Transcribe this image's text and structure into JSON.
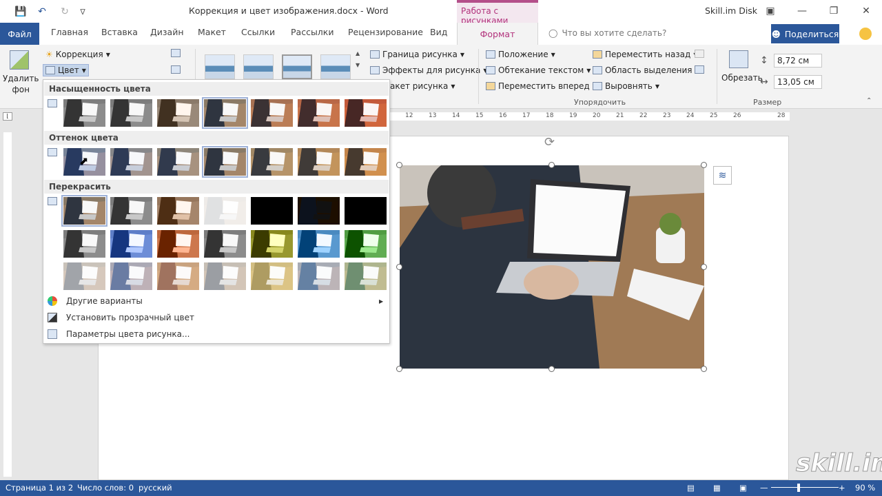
{
  "titlebar": {
    "doc_title": "Коррекция и цвет изображения.docx  -  Word",
    "context_title": "Работа с рисунками",
    "account": "Skill.im Disk",
    "qat_icons": [
      "save-icon",
      "undo-icon",
      "redo-icon",
      "customize-icon"
    ]
  },
  "tabs": {
    "file": "Файл",
    "items": [
      "Главная",
      "Вставка",
      "Дизайн",
      "Макет",
      "Ссылки",
      "Рассылки",
      "Рецензирование",
      "Вид"
    ],
    "format": "Формат",
    "tell_me": "Что вы хотите сделать?",
    "share": "Поделиться"
  },
  "ribbon": {
    "remove_bg": "Удалить фон",
    "correction": "Коррекция",
    "color": "Цвет",
    "border": "Граница рисунка",
    "effects": "Эффекты для рисунка",
    "layout": "акет рисунка",
    "position": "Положение",
    "wrap": "Обтекание текстом",
    "forward": "Переместить вперед",
    "backward": "Переместить назад",
    "selection": "Область выделения",
    "align": "Выровнять",
    "arrange_label": "Упорядочить",
    "crop": "Обрезать",
    "height": "8,72 см",
    "width": "13,05 см",
    "size_label": "Размер"
  },
  "dropdown": {
    "saturation_header": "Насыщенность цвета",
    "tone_header": "Оттенок цвета",
    "recolor_header": "Перекрасить",
    "more": "Другие варианты",
    "transparent": "Установить прозрачный цвет",
    "options": "Параметры цвета рисунка..."
  },
  "ruler": {
    "ticks": [
      "12",
      "13",
      "14",
      "15",
      "16",
      "17",
      "18",
      "19",
      "20",
      "21",
      "22",
      "23",
      "24",
      "25",
      "26",
      "28"
    ]
  },
  "statusbar": {
    "page": "Страница 1 из 2",
    "words": "Число слов: 0",
    "lang": "русский",
    "zoom": "90 %"
  },
  "watermark": "skill.im"
}
